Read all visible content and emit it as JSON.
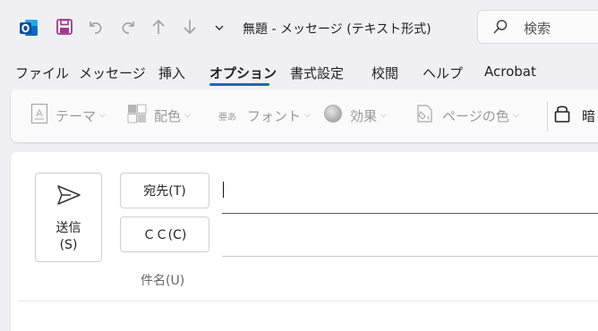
{
  "window": {
    "title": "無題  -  メッセージ (テキスト形式)",
    "search_placeholder": "検索"
  },
  "quick_access": {
    "app_icon": "outlook-icon",
    "items": [
      "save-icon",
      "undo-icon",
      "redo-icon",
      "up-arrow-icon",
      "down-arrow-icon",
      "customize-chevron-icon"
    ]
  },
  "tabs": [
    {
      "label": "ファイル",
      "active": false
    },
    {
      "label": "メッセージ",
      "active": false
    },
    {
      "label": "挿入",
      "active": false
    },
    {
      "label": "オプション",
      "active": true
    },
    {
      "label": "書式設定",
      "active": false
    },
    {
      "label": "校閲",
      "active": false
    },
    {
      "label": "ヘルプ",
      "active": false
    },
    {
      "label": "Acrobat",
      "active": false
    }
  ],
  "ribbon": {
    "theme": "テーマ",
    "colors": "配色",
    "font_icon_text": "亜あ",
    "fonts": "フォント",
    "effects": "効果",
    "page_color": "ページの色",
    "encrypt": "暗"
  },
  "compose": {
    "send_label_1": "送信",
    "send_label_2": "(S)",
    "to_button": "宛先(T)",
    "cc_button": "ＣＣ(C)",
    "subject_label": "件名(U)",
    "to_value": "",
    "cc_value": "",
    "subject_value": ""
  },
  "colors": {
    "accent": "#0f6cbd",
    "outlook_blue": "#0f6cbd",
    "save_purple": "#9b3a8e",
    "disabled_gray": "#9a9a9a"
  }
}
